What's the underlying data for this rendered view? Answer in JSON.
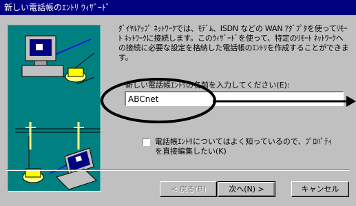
{
  "window": {
    "title": "新しい電話帳のｴﾝﾄﾘ ｳｨｻﾞｰﾄﾞ"
  },
  "description": "ﾀﾞｲﾔﾙｱｯﾌﾟ ﾈｯﾄﾜｰｸでは、ﾓﾃﾞﾑ、ISDN などの WAN ｱﾀﾞﾌﾟﾀを使ってﾘﾓｰﾄ ﾈｯﾄﾜｰｸに接続します。このｳｨｻﾞｰﾄﾞを使って、特定のﾘﾓｰﾄ ﾈｯﾄﾜｰｸへの接続に必要な設定を格納した電話帳のｴﾝﾄﾘを作成することができます。",
  "entry_name": {
    "label": "新しい電話帳ｴﾝﾄﾘの名前を入力してください(E):",
    "value": "ABCnet"
  },
  "option": {
    "label": "電話帳ｴﾝﾄﾘについてはよく知っているので、ﾌﾟﾛﾊﾟﾃｨを直接編集したい(K)",
    "checked": false
  },
  "buttons": {
    "back": "< 戻る(B)",
    "next": "次へ(N) >",
    "cancel": "キャンセル"
  },
  "colors": {
    "title_bar": "#000080",
    "illustration_bg": "#008080",
    "annotation": "#000000"
  }
}
